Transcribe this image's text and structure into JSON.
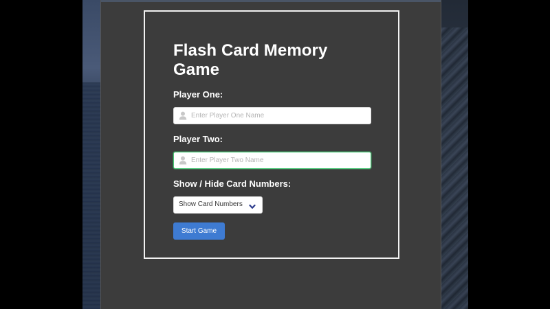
{
  "game": {
    "title": "Flash Card Memory Game"
  },
  "form": {
    "player_one": {
      "label": "Player One:",
      "value": "",
      "placeholder": "Enter Player One Name",
      "icon": "user-icon"
    },
    "player_two": {
      "label": "Player Two:",
      "value": "",
      "placeholder": "Enter Player Two Name",
      "icon": "user-icon"
    },
    "card_numbers": {
      "label": "Show / Hide Card Numbers:",
      "selected": "Show Card Numbers",
      "icon": "chevron-down-icon"
    },
    "start_button": {
      "label": "Start Game"
    }
  },
  "colors": {
    "background": "#3c3c3c",
    "border": "#f2f2f2",
    "accent": "#3e7bd2",
    "focus": "#48c774",
    "chevron": "#2b3a8c"
  }
}
